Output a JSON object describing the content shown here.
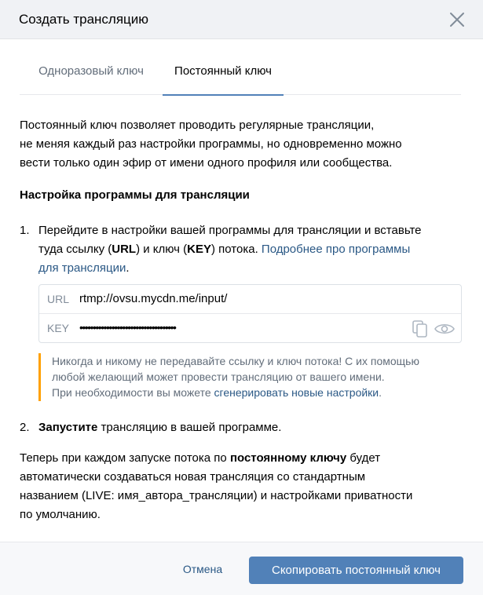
{
  "dialog": {
    "title": "Создать трансляцию",
    "close_icon": "close-icon"
  },
  "tabs": [
    {
      "label": "Одноразовый ключ",
      "active": false
    },
    {
      "label": "Постоянный ключ",
      "active": true
    }
  ],
  "description": {
    "line1": "Постоянный ключ позволяет проводить регулярные трансляции,",
    "line2": "не меняя каждый раз настройки программы, но одновременно можно",
    "line3": "вести только один эфир от имени одного профиля или сообщества."
  },
  "setup": {
    "title": "Настройка программы для трансляции",
    "step1": {
      "num": "1.",
      "line1": "Перейдите в настройки вашей программы для трансляции и вставьте",
      "line2_a": "туда ссылку (",
      "line2_url": "URL",
      "line2_b": ") и ключ (",
      "line2_key": "KEY",
      "line2_c": ") потока. ",
      "line2_link": "Подробнее про программы",
      "line3_link": "для трансляции",
      "line3_end": "."
    },
    "credentials": {
      "url_label": "URL",
      "url_value": "rtmp://ovsu.mycdn.me/input/",
      "key_label": "KEY",
      "key_value": "••••••••••••••••••••••••••••••••••••",
      "copy_icon": "copy-icon",
      "eye_icon": "eye-icon"
    },
    "warning": {
      "line1": "Никогда и никому не передавайте ссылку и ключ потока! С их помощью",
      "line2": "любой желающий может провести трансляцию от вашего имени.",
      "line3_a": "При необходимости вы можете ",
      "line3_link": "сгенерировать новые настройки",
      "line3_end": "."
    },
    "step2": {
      "num": "2.",
      "bold": "Запустите",
      "rest": " трансляцию в вашей программе."
    }
  },
  "final_note": {
    "line1_a": "Теперь при каждом запуске потока по ",
    "line1_bold": "постоянному ключу",
    "line1_b": " будет",
    "line2": "автоматически создаваться новая трансляция со стандартным",
    "line3": "названием (LIVE: имя_автора_трансляции) и настройками приватности",
    "line4": "по умолчанию."
  },
  "footer": {
    "cancel_label": "Отмена",
    "primary_label": "Скопировать постоянный ключ"
  },
  "colors": {
    "accent": "#5181b8",
    "link": "#2a5885",
    "warning_bar": "#ffa000",
    "header_bg": "#f0f2f5"
  }
}
